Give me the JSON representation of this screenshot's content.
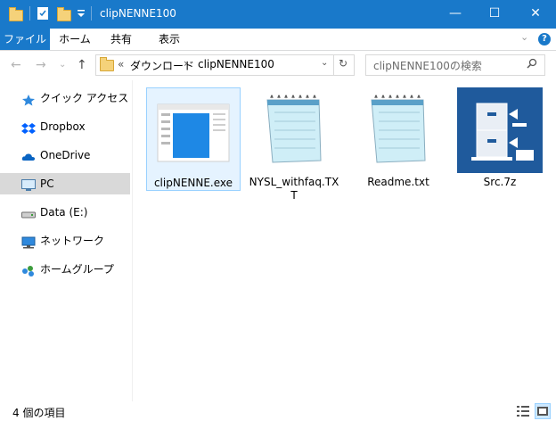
{
  "window": {
    "title": "clipNENNE100"
  },
  "titlebar": {
    "minimize": "—",
    "maximize": "☐",
    "close": "✕"
  },
  "ribbon": {
    "tabs": [
      "ファイル",
      "ホーム",
      "共有",
      "表示"
    ]
  },
  "address": {
    "overflow": "«",
    "crumbs": [
      "ダウンロード",
      "clipNENNE100"
    ],
    "separator": "›"
  },
  "search": {
    "placeholder": "clipNENNE100の検索"
  },
  "nav": {
    "items": [
      {
        "label": "クイック アクセス",
        "icon": "star-icon"
      },
      {
        "label": "Dropbox",
        "icon": "dropbox-icon"
      },
      {
        "label": "OneDrive",
        "icon": "cloud-icon"
      },
      {
        "label": "PC",
        "icon": "monitor-icon"
      },
      {
        "label": "Data (E:)",
        "icon": "drive-icon"
      },
      {
        "label": "ネットワーク",
        "icon": "network-icon"
      },
      {
        "label": "ホームグループ",
        "icon": "homegroup-icon"
      }
    ]
  },
  "files": [
    {
      "name": "clipNENNE.exe",
      "type": "exe",
      "selected": true
    },
    {
      "name": "NYSL_withfaq.TXT",
      "type": "notepad"
    },
    {
      "name": "Readme.txt",
      "type": "notepad"
    },
    {
      "name": "Src.7z",
      "type": "archive"
    }
  ],
  "status": {
    "count": "4 個の項目"
  },
  "colors": {
    "accent": "#1979ca",
    "selected_bg": "#e5f3ff",
    "selected_border": "#99d1ff",
    "nav_pc": "#d9d9d9"
  }
}
